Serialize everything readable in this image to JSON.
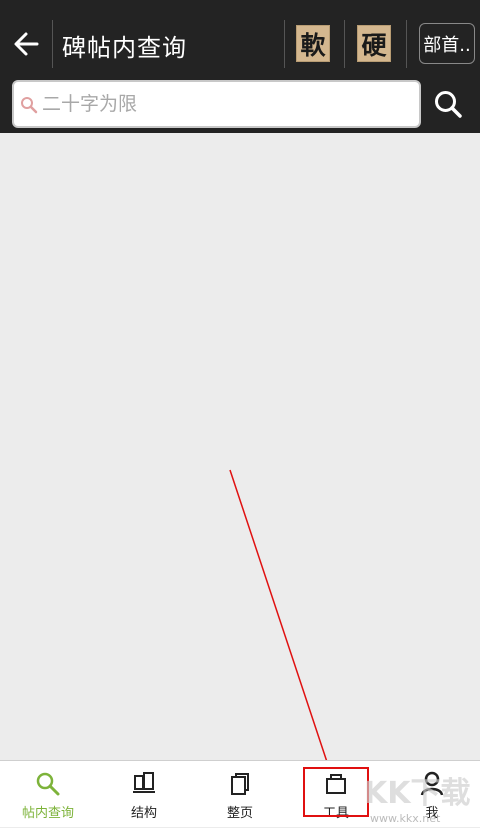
{
  "header": {
    "title": "碑帖内查询",
    "glyph_buttons": [
      {
        "char": "軟"
      },
      {
        "char": "硬"
      }
    ],
    "radical_button": "部首..",
    "back_icon": "arrow-left-icon",
    "search_icon": "search-icon"
  },
  "search": {
    "placeholder": "二十字为限",
    "value": ""
  },
  "tabs": [
    {
      "label": "帖内查询",
      "icon": "search-icon",
      "active": true
    },
    {
      "label": "结构",
      "icon": "structure-icon",
      "active": false
    },
    {
      "label": "整页",
      "icon": "page-icon",
      "active": false
    },
    {
      "label": "工具",
      "icon": "toolbox-icon",
      "active": false
    },
    {
      "label": "我",
      "icon": "user-icon",
      "active": false
    }
  ],
  "watermark": {
    "text": "KK下载",
    "url": "www.kkx.net"
  },
  "colors": {
    "header_bg": "#232323",
    "content_bg": "#ececec",
    "active_tab": "#7db33a",
    "annotation_red": "#e01010"
  }
}
